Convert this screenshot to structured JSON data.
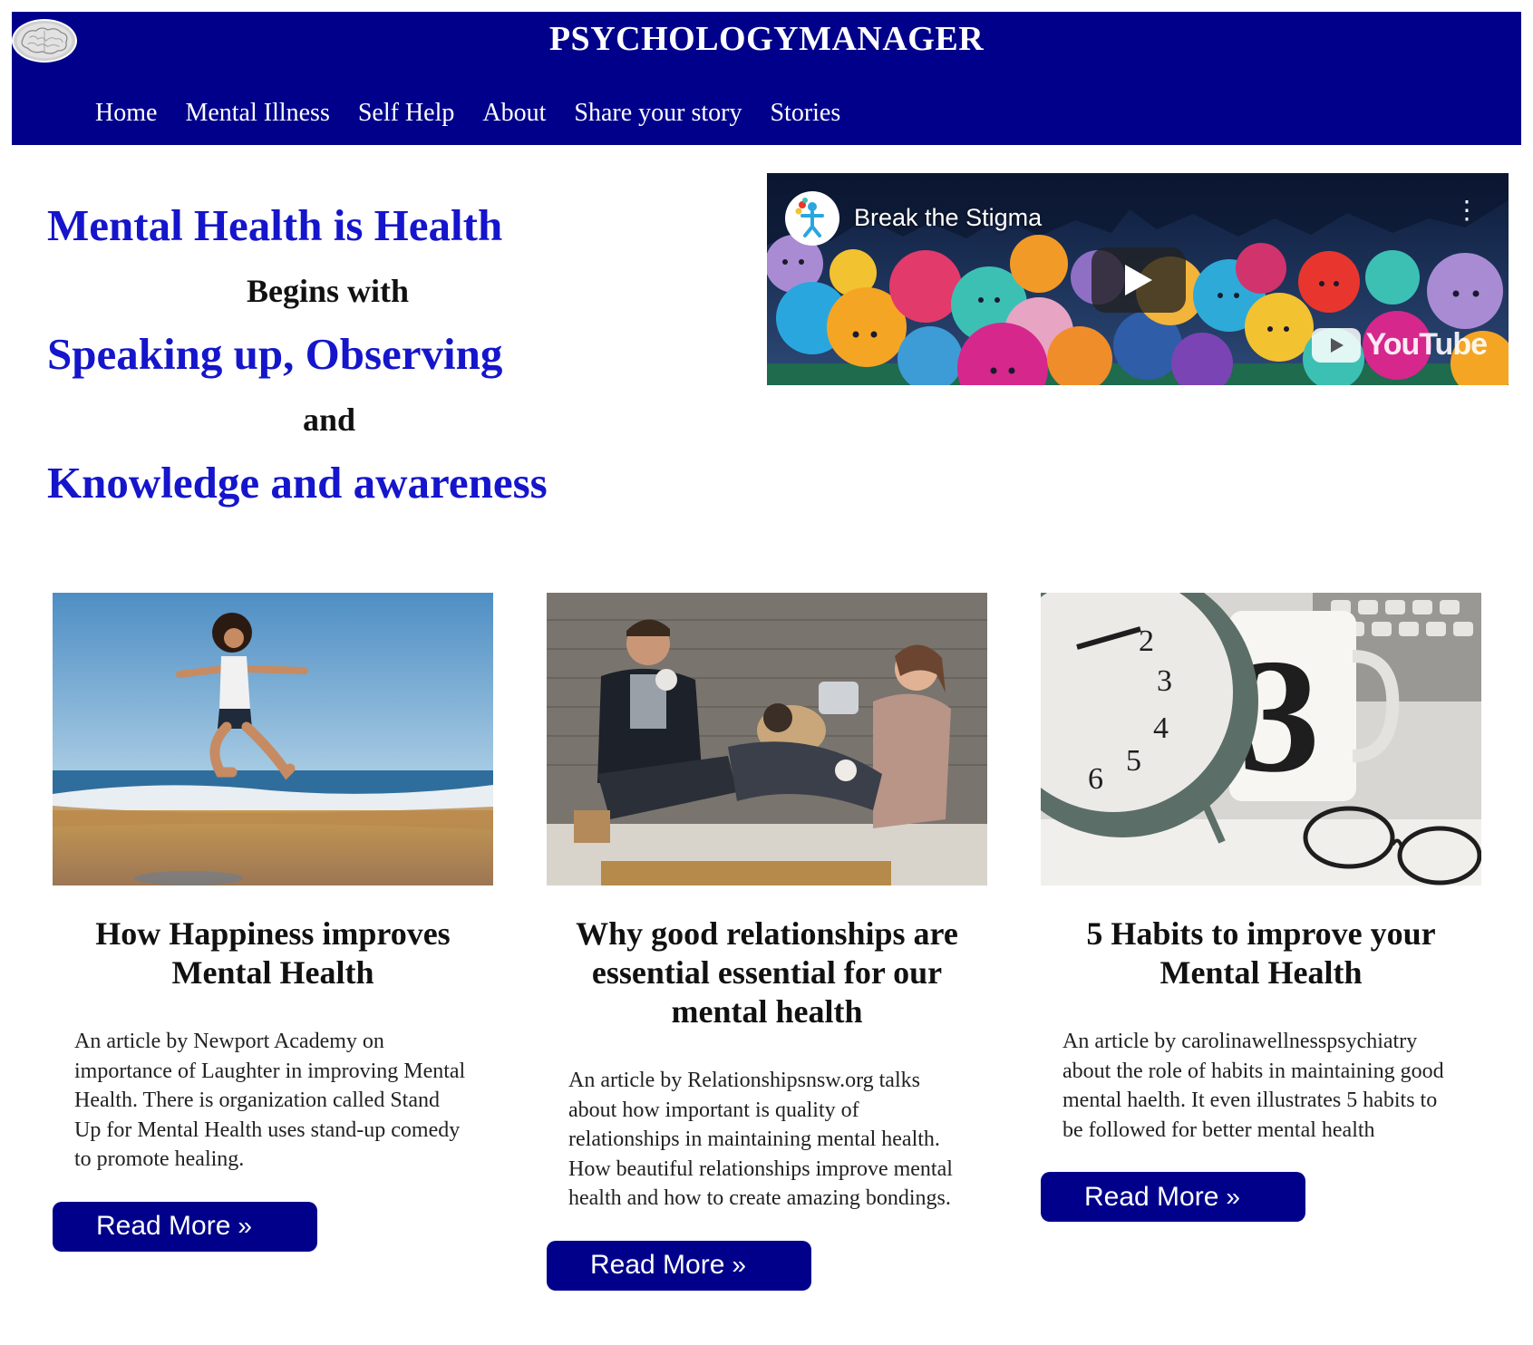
{
  "header": {
    "site_title": "PSYCHOLOGYMANAGER",
    "background_color": "#00008b",
    "logo_icon": "brain-icon"
  },
  "nav": {
    "items": [
      {
        "label": "Home"
      },
      {
        "label": "Mental Illness"
      },
      {
        "label": "Self Help"
      },
      {
        "label": "About"
      },
      {
        "label": "Share your story"
      },
      {
        "label": "Stories"
      }
    ]
  },
  "hero": {
    "line1": "Mental Health is Health",
    "line2": "Begins with",
    "line3": "Speaking up, Observing",
    "line4": "and",
    "line5": "Knowledge and awareness",
    "accent_color": "#1515cc"
  },
  "video": {
    "title": "Break the Stigma",
    "menu_glyph": "⋮",
    "platform_label": "YouTube",
    "play_icon": "play-icon"
  },
  "cards": [
    {
      "title": "How Happiness improves Mental Health",
      "description": "An article by Newport Academy on importance of Laughter in improving Mental Health. There is organization called Stand Up for Mental Health uses stand-up comedy to promote healing.",
      "button_label": "Read More",
      "button_glyph": "»"
    },
    {
      "title": "Why good relationships are essential essential for our mental health",
      "description": "An article by Relationshipsnsw.org talks about how important is quality of relationships in maintaining mental health. How beautiful relationships improve mental health and how to create amazing bondings.",
      "button_label": "Read More",
      "button_glyph": "»"
    },
    {
      "title": "5 Habits to improve your Mental Health",
      "description": "An article by carolinawellnesspsychiatry about the role of habits in maintaining good mental haelth. It even illustrates 5 habits to be followed for better mental health",
      "button_label": "Read More",
      "button_glyph": "»"
    }
  ],
  "button_color": "#00008b"
}
